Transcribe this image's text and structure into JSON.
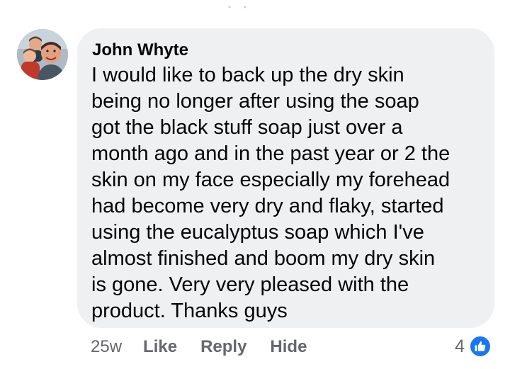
{
  "colors": {
    "bubble_background": "#eff0f2",
    "text_primary": "#050505",
    "text_secondary": "#65676b",
    "like_blue": "#1877f2"
  },
  "comment": {
    "avatar_icon": "profile-photo",
    "author": "John Whyte",
    "text_lines": [
      "I would like to back up the dry skin",
      "being no longer after using the soap",
      "got the black stuff soap just over a",
      "month ago and in the past year or 2 the",
      "skin on my face especially my forehead",
      "had become very dry and flaky, started",
      "using the eucalyptus soap which I've",
      "almost finished and boom my dry skin",
      "is gone. Very very pleased with the",
      "product. Thanks guys"
    ]
  },
  "actions": {
    "timestamp": "25w",
    "like_label": "Like",
    "reply_label": "Reply",
    "hide_label": "Hide"
  },
  "reactions": {
    "count": "4",
    "icon": "thumbs-up-icon"
  }
}
